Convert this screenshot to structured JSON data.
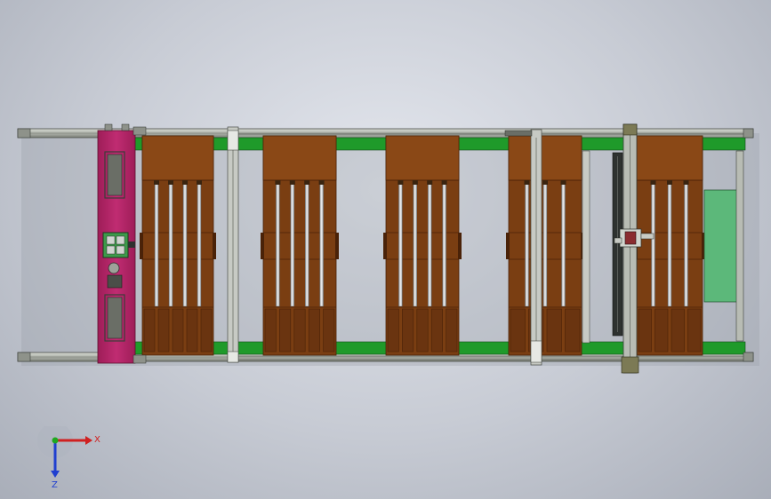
{
  "view": {
    "background": "#c9cdd5",
    "model_name": "conveyor-line-top-view"
  },
  "colors": {
    "frame_rail": "#b8bcb4",
    "frame_rail_dark": "#5e625a",
    "green_beam": "#1f9a2a",
    "brown_fixture": "#7a3e12",
    "brown_fixture_dark": "#4a2208",
    "pink_carriage": "#b8266a",
    "light_green_plate": "#5cb87a",
    "steel_rod": "#d7d9dc",
    "dark_rail": "#2e3230",
    "bracket_gray": "#8e928a"
  },
  "triad": {
    "x_label": "X",
    "z_label": "Z",
    "x_color": "#d02020",
    "y_color": "#1fa81f",
    "z_color": "#1f3fd0"
  }
}
